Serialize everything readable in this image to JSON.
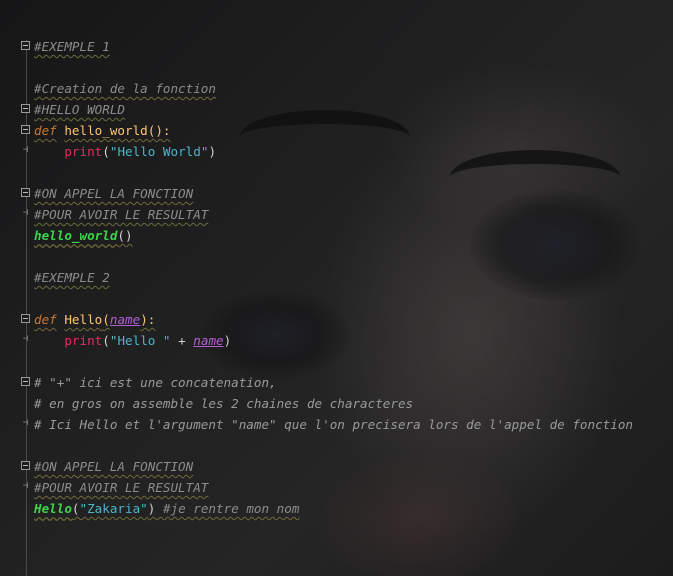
{
  "editor": {
    "lines": {
      "l1": "#EXEMPLE 1",
      "l3": "#Creation de la fonction",
      "l4": "#HELLO WORLD",
      "l5": {
        "kw": "def",
        "name": "hello_world",
        "rest": "():"
      },
      "l6": {
        "builtin": "print",
        "open": "(",
        "str": "\"Hello World\"",
        "close": ")"
      },
      "l8": "#ON APPEL LA FONCTION",
      "l9": "#POUR AVOIR LE RESULTAT",
      "l10": {
        "call": "hello_world",
        "rest": "()"
      },
      "l12": "#EXEMPLE 2",
      "l14": {
        "kw": "def",
        "name": "Hello",
        "open": "(",
        "param": "name",
        "close": "):"
      },
      "l15": {
        "builtin": "print",
        "open": "(",
        "str": "\"Hello \"",
        "plus": " + ",
        "param": "name",
        "close": ")"
      },
      "l17": "# \"+\" ici est une concatenation,",
      "l18": "# en gros on assemble les 2 chaines de characteres",
      "l19": "# Ici Hello et l'argument \"name\" que l'on precisera lors de l'appel de fonction",
      "l21": "#ON APPEL LA FONCTION",
      "l22": "#POUR AVOIR LE RESULTAT",
      "l23": {
        "call": "Hello",
        "open": "(",
        "str": "\"Zakaria\"",
        "close": ")",
        "comment": " #je rentre mon nom"
      }
    }
  }
}
